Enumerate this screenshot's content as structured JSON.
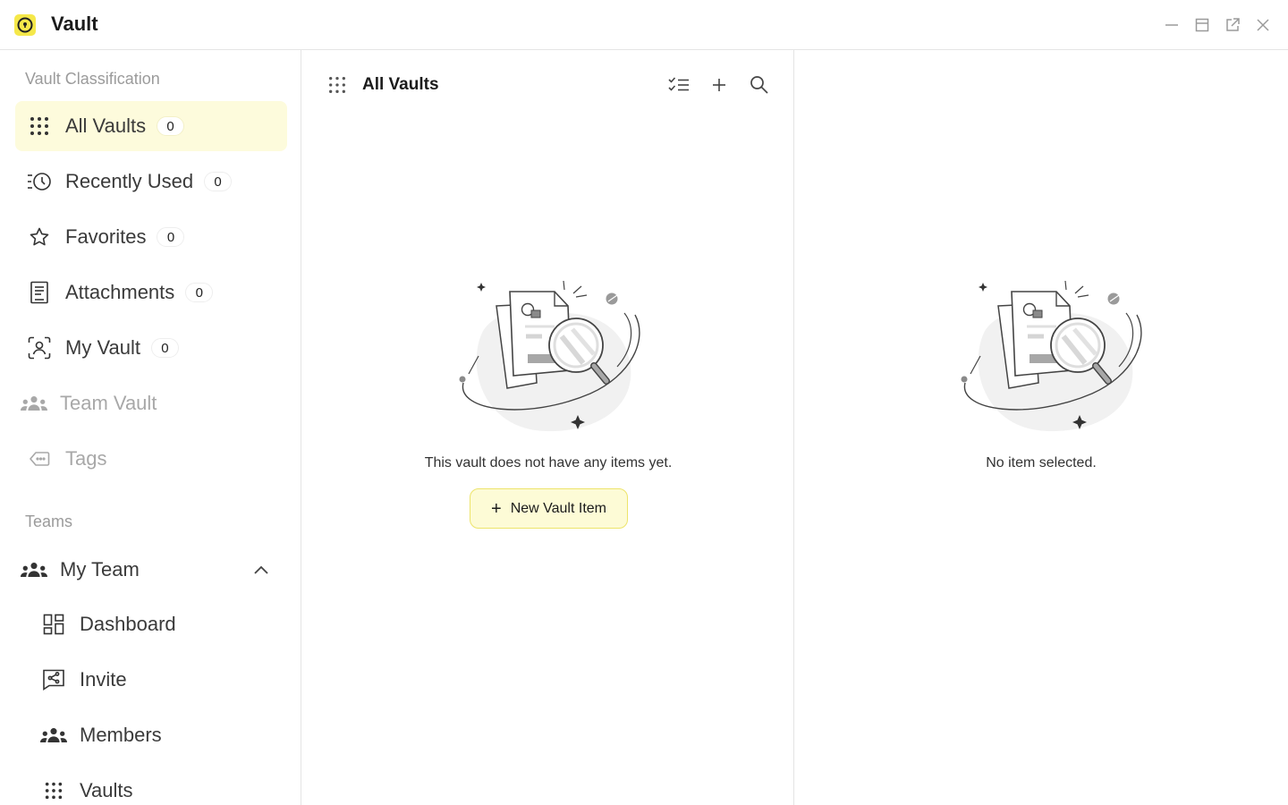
{
  "window": {
    "title": "Vault",
    "accent_color": "#f5e84a"
  },
  "sidebar": {
    "classification_title": "Vault Classification",
    "items": [
      {
        "label": "All Vaults",
        "count": "0",
        "icon": "grid-dots-icon",
        "active": true
      },
      {
        "label": "Recently Used",
        "count": "0",
        "icon": "recent-clock-icon"
      },
      {
        "label": "Favorites",
        "count": "0",
        "icon": "star-icon"
      },
      {
        "label": "Attachments",
        "count": "0",
        "icon": "document-icon"
      },
      {
        "label": "My Vault",
        "count": "0",
        "icon": "person-scan-icon"
      },
      {
        "label": "Team Vault",
        "icon": "team-icon",
        "disabled": true
      },
      {
        "label": "Tags",
        "icon": "tag-icon",
        "disabled": true
      }
    ],
    "teams_title": "Teams",
    "team": {
      "label": "My Team",
      "icon": "team-icon",
      "children": [
        {
          "label": "Dashboard",
          "icon": "dashboard-icon"
        },
        {
          "label": "Invite",
          "icon": "share-icon"
        },
        {
          "label": "Members",
          "icon": "members-icon"
        },
        {
          "label": "Vaults",
          "icon": "grid-dots-icon"
        }
      ]
    }
  },
  "list": {
    "title": "All Vaults",
    "empty_message": "This vault does not have any items yet.",
    "new_button_label": "New Vault Item"
  },
  "detail": {
    "empty_message": "No item selected."
  }
}
